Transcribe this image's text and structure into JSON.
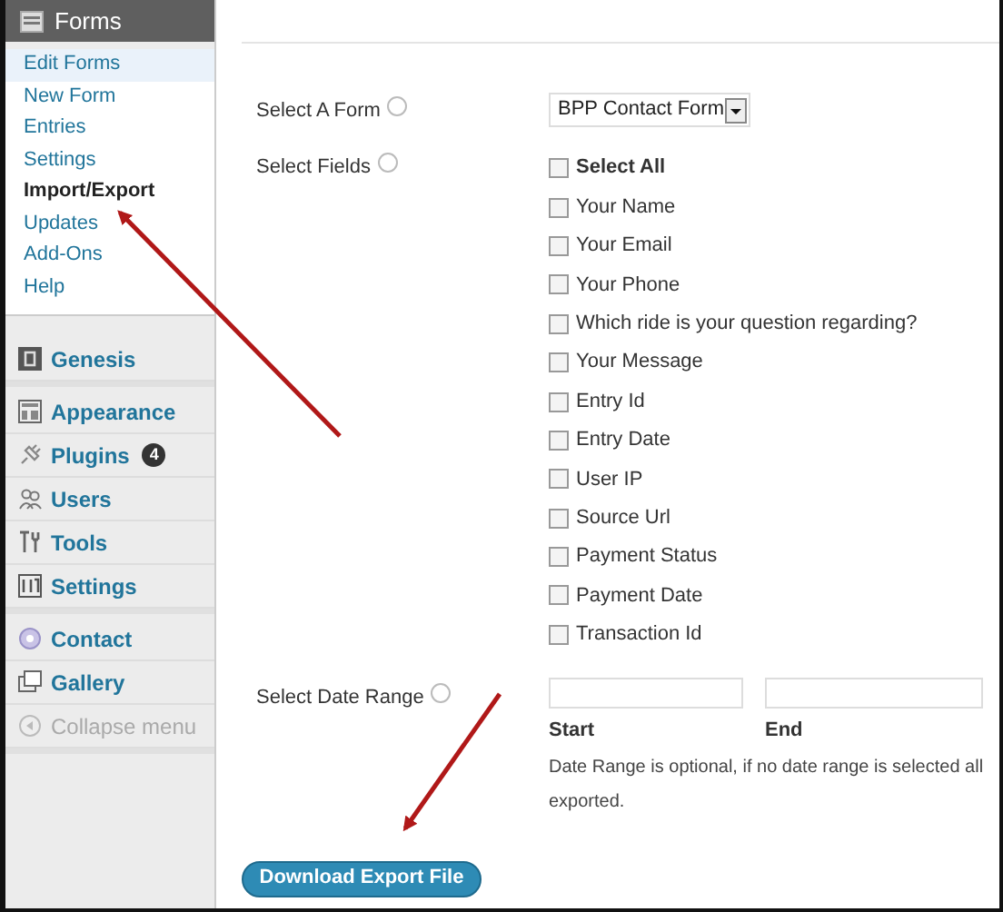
{
  "sidebar": {
    "header": "Forms",
    "submenu": [
      {
        "label": "Edit Forms",
        "selected": false,
        "highlighted": true
      },
      {
        "label": "New Form",
        "selected": false,
        "highlighted": false
      },
      {
        "label": "Entries",
        "selected": false,
        "highlighted": false
      },
      {
        "label": "Settings",
        "selected": false,
        "highlighted": false
      },
      {
        "label": "Import/Export",
        "selected": true,
        "highlighted": false
      },
      {
        "label": "Updates",
        "selected": false,
        "highlighted": false
      },
      {
        "label": "Add-Ons",
        "selected": false,
        "highlighted": false
      },
      {
        "label": "Help",
        "selected": false,
        "highlighted": false
      }
    ],
    "groups": [
      [
        {
          "label": "Genesis"
        }
      ],
      [
        {
          "label": "Appearance"
        },
        {
          "label": "Plugins",
          "badge": "4"
        },
        {
          "label": "Users"
        },
        {
          "label": "Tools"
        },
        {
          "label": "Settings"
        }
      ],
      [
        {
          "label": "Contact"
        },
        {
          "label": "Gallery"
        },
        {
          "label": "Collapse menu",
          "disabled": true
        }
      ]
    ]
  },
  "form": {
    "select_form": {
      "label": "Select A Form",
      "value": "BPP Contact Form"
    },
    "select_fields": {
      "label": "Select Fields",
      "options": [
        {
          "label": "Select All",
          "checked": false,
          "bold": true
        },
        {
          "label": "Your Name",
          "checked": false,
          "bold": false
        },
        {
          "label": "Your Email",
          "checked": false,
          "bold": false
        },
        {
          "label": "Your Phone",
          "checked": false,
          "bold": false
        },
        {
          "label": "Which ride is your question regarding?",
          "checked": false,
          "bold": false
        },
        {
          "label": "Your Message",
          "checked": false,
          "bold": false
        },
        {
          "label": "Entry Id",
          "checked": false,
          "bold": false
        },
        {
          "label": "Entry Date",
          "checked": false,
          "bold": false
        },
        {
          "label": "User IP",
          "checked": false,
          "bold": false
        },
        {
          "label": "Source Url",
          "checked": false,
          "bold": false
        },
        {
          "label": "Payment Status",
          "checked": false,
          "bold": false
        },
        {
          "label": "Payment Date",
          "checked": false,
          "bold": false
        },
        {
          "label": "Transaction Id",
          "checked": false,
          "bold": false
        }
      ]
    },
    "date_range": {
      "label": "Select Date Range",
      "start_label": "Start",
      "end_label": "End",
      "note_line_1": "Date Range is optional, if no date range is selected all",
      "note_line_2": "exported."
    },
    "submit": "Download Export File"
  }
}
